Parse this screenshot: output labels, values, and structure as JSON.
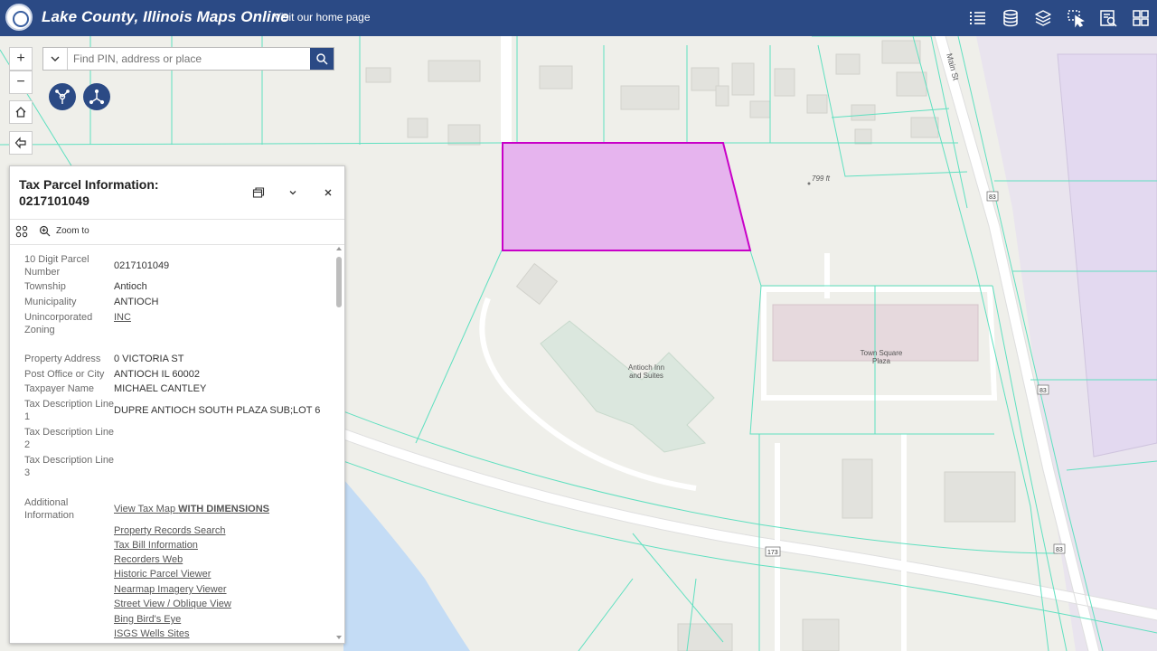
{
  "header": {
    "title": "Lake County, Illinois Maps Online",
    "home_link": "Visit our home page",
    "tools": [
      "list-icon",
      "database-icon",
      "layers-icon",
      "select-icon",
      "query-icon",
      "grid-icon"
    ]
  },
  "map_controls": {
    "zoom_in": "+",
    "zoom_out": "−"
  },
  "search": {
    "placeholder": "Find PIN, address or place"
  },
  "map_labels": {
    "main_st": "Main St",
    "elevation": "799 ft",
    "route_83": "83",
    "route_173": "173",
    "town_square_line1": "Town Square",
    "town_square_line2": "Plaza",
    "antioch_line1": "Antioch Inn",
    "antioch_line2": "and Suites"
  },
  "popup": {
    "title": "Tax Parcel Information:",
    "parcel_id": "0217101049",
    "zoom_to": "Zoom to",
    "fields": [
      {
        "label": "10 Digit Parcel Number",
        "value": "0217101049"
      },
      {
        "label": "Township",
        "value": "Antioch"
      },
      {
        "label": "Municipality",
        "value": "ANTIOCH"
      },
      {
        "label": "Unincorporated Zoning",
        "value": "INC"
      },
      {
        "label": "Property Address",
        "value": "0 VICTORIA ST"
      },
      {
        "label": "Post Office or City",
        "value": "ANTIOCH IL 60002"
      },
      {
        "label": "Taxpayer Name",
        "value": "MICHAEL CANTLEY"
      },
      {
        "label": "Tax Description Line 1",
        "value": "DUPRE ANTIOCH SOUTH PLAZA SUB;LOT 6"
      },
      {
        "label": "Tax Description Line 2",
        "value": ""
      },
      {
        "label": "Tax Description Line 3",
        "value": ""
      }
    ],
    "additional_label": "Additional Information",
    "tax_map_link": "View Tax Map",
    "tax_map_bold": "WITH DIMENSIONS",
    "links": [
      "Property Records Search",
      "Tax Bill Information",
      "Recorders Web",
      "Historic Parcel Viewer",
      "Nearmap Imagery Viewer",
      "Street View / Oblique View",
      "Bing Bird's Eye",
      "ISGS Wells Sites"
    ]
  },
  "colors": {
    "header": "#2b4a85",
    "selected_parcel": "#c800c8",
    "parcel_lines": "#5fe0c0",
    "water": "#c4dcf5"
  }
}
